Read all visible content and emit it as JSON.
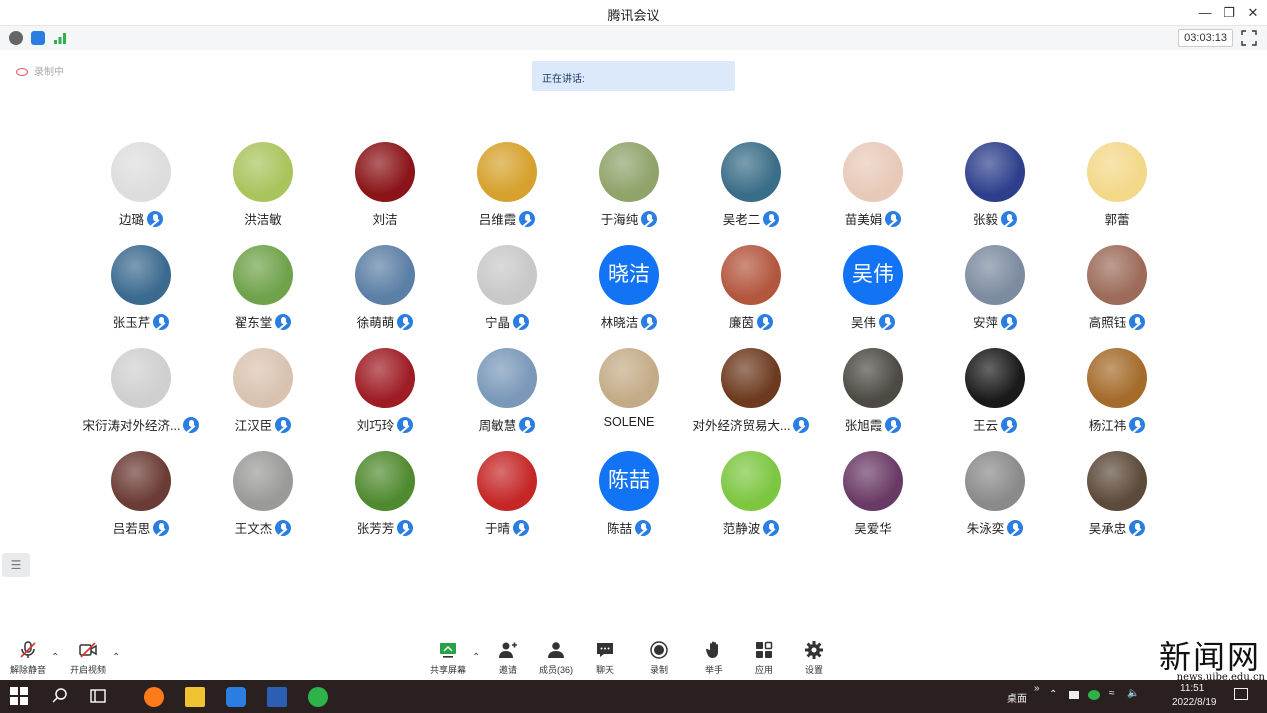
{
  "window": {
    "title": "腾讯会议"
  },
  "infobar": {
    "timer": "03:03:13"
  },
  "recording": {
    "label": "录制中"
  },
  "speaking": {
    "label": "正在讲话:"
  },
  "participants": [
    {
      "name": "边璐",
      "avatar_type": "photo",
      "color": "#dddddd",
      "muted": true
    },
    {
      "name": "洪洁敏",
      "avatar_type": "photo",
      "color": "#a9c45c",
      "muted": false
    },
    {
      "name": "刘洁",
      "avatar_type": "photo",
      "color": "#8a1418",
      "muted": false
    },
    {
      "name": "吕维霞",
      "avatar_type": "photo",
      "color": "#d6a12c",
      "muted": true
    },
    {
      "name": "于海纯",
      "avatar_type": "photo",
      "color": "#8fa36a",
      "muted": true
    },
    {
      "name": "吴老二",
      "avatar_type": "photo",
      "color": "#3a6d88",
      "muted": true
    },
    {
      "name": "苗美娟",
      "avatar_type": "photo",
      "color": "#e8c9b8",
      "muted": true
    },
    {
      "name": "张毅",
      "avatar_type": "photo",
      "color": "#2d3f8c",
      "muted": true
    },
    {
      "name": "郭蕾",
      "avatar_type": "photo",
      "color": "#f3d889",
      "muted": false
    },
    {
      "name": "张玉芹",
      "avatar_type": "photo",
      "color": "#3b6a8f",
      "muted": true
    },
    {
      "name": "翟东堂",
      "avatar_type": "photo",
      "color": "#6fa24a",
      "muted": true
    },
    {
      "name": "徐萌萌",
      "avatar_type": "photo",
      "color": "#5b7fa5",
      "muted": true
    },
    {
      "name": "宁晶",
      "avatar_type": "photo",
      "color": "#c8c8c8",
      "muted": true
    },
    {
      "name": "林晓洁",
      "avatar_type": "text",
      "initials": "晓洁",
      "color": "#1273f5",
      "muted": true
    },
    {
      "name": "廉茵",
      "avatar_type": "photo",
      "color": "#b3563e",
      "muted": true
    },
    {
      "name": "吴伟",
      "avatar_type": "text",
      "initials": "吴伟",
      "color": "#1273f5",
      "muted": true
    },
    {
      "name": "安萍",
      "avatar_type": "photo",
      "color": "#7c8ba0",
      "muted": true
    },
    {
      "name": "高照钰",
      "avatar_type": "photo",
      "color": "#9c6b5a",
      "muted": true
    },
    {
      "name": "宋衍涛对外经济...",
      "avatar_type": "photo",
      "color": "#cfcfcf",
      "muted": true
    },
    {
      "name": "江汉臣",
      "avatar_type": "photo",
      "color": "#d9c3b0",
      "muted": true
    },
    {
      "name": "刘巧玲",
      "avatar_type": "photo",
      "color": "#9e1c24",
      "muted": true
    },
    {
      "name": "周敏慧",
      "avatar_type": "photo",
      "color": "#7a98b8",
      "muted": true
    },
    {
      "name": "SOLENE",
      "avatar_type": "photo",
      "color": "#c4ab87",
      "muted": false
    },
    {
      "name": "对外经济贸易大...",
      "avatar_type": "photo",
      "color": "#6d3a1f",
      "muted": true
    },
    {
      "name": "张旭霞",
      "avatar_type": "photo",
      "color": "#4d4a43",
      "muted": true
    },
    {
      "name": "王云",
      "avatar_type": "photo",
      "color": "#1a1a1a",
      "muted": true
    },
    {
      "name": "杨江祎",
      "avatar_type": "photo",
      "color": "#a46b2a",
      "muted": true
    },
    {
      "name": "吕若思",
      "avatar_type": "photo",
      "color": "#6b3b35",
      "muted": true
    },
    {
      "name": "王文杰",
      "avatar_type": "photo",
      "color": "#9a9a98",
      "muted": true
    },
    {
      "name": "张芳芳",
      "avatar_type": "photo",
      "color": "#4f8a2f",
      "muted": true
    },
    {
      "name": "于晴",
      "avatar_type": "photo",
      "color": "#c52727",
      "muted": true
    },
    {
      "name": "陈喆",
      "avatar_type": "text",
      "initials": "陈喆",
      "color": "#1273f5",
      "muted": true
    },
    {
      "name": "范静波",
      "avatar_type": "photo",
      "color": "#7cc640",
      "muted": true
    },
    {
      "name": "吴爱华",
      "avatar_type": "photo",
      "color": "#6a3a66",
      "muted": false
    },
    {
      "name": "朱泳奕",
      "avatar_type": "photo",
      "color": "#8a8a8a",
      "muted": true
    },
    {
      "name": "吴承忠",
      "avatar_type": "photo",
      "color": "#5c4a3a",
      "muted": true
    }
  ],
  "toolbar": {
    "unmute": "解除静音",
    "start_video": "开启视频",
    "share_screen": "共享屏幕",
    "invite": "邀请",
    "members": "成员(36)",
    "chat": "聊天",
    "record": "录制",
    "raise_hand": "举手",
    "apps": "应用",
    "settings": "设置"
  },
  "taskbar": {
    "desktop_label": "桌面",
    "time": "11:51",
    "date": "2022/8/19"
  },
  "watermark": {
    "title": "新闻网",
    "url": "news.uibe.edu.cn"
  },
  "colors": {
    "accent": "#1273f5",
    "speaking_bg": "#dce9fb",
    "taskbar": "#2b2020"
  }
}
